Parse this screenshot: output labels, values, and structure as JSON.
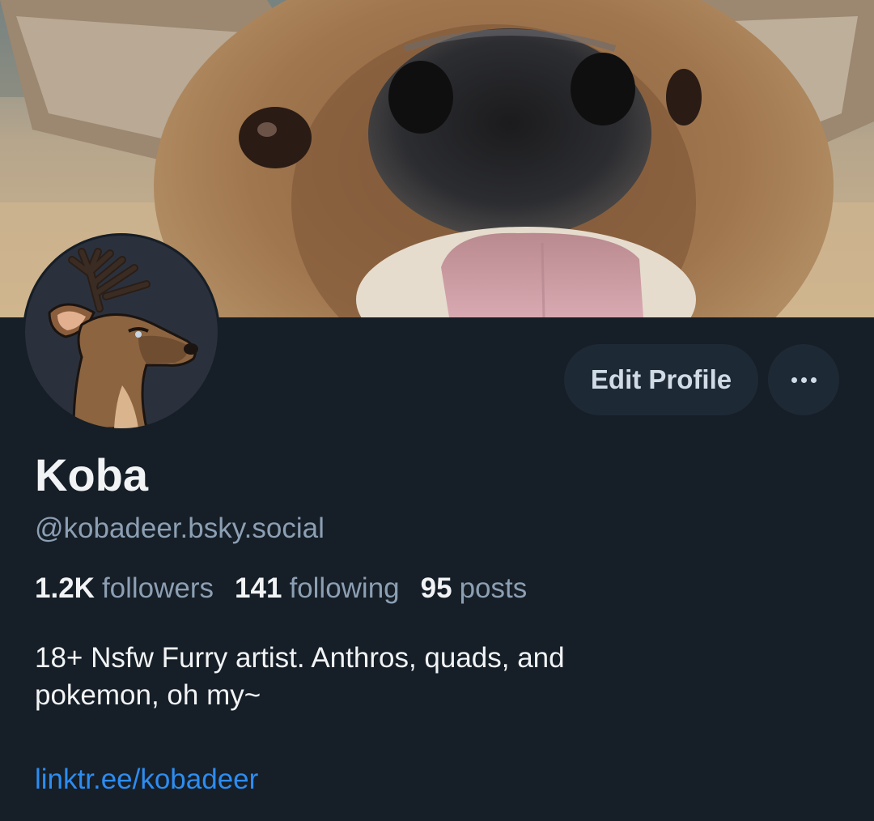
{
  "profile": {
    "display_name": "Koba",
    "handle": "@kobadeer.bsky.social",
    "stats": {
      "followers_count": "1.2K",
      "followers_label": "followers",
      "following_count": "141",
      "following_label": "following",
      "posts_count": "95",
      "posts_label": "posts"
    },
    "bio_line1": "18+ Nsfw Furry artist. Anthros, quads, and",
    "bio_line2": "pokemon, oh my~",
    "link": "linktr.ee/kobadeer"
  },
  "actions": {
    "edit_label": "Edit Profile",
    "more_icon": "ellipsis-icon"
  },
  "colors": {
    "background": "#161e27",
    "button_bg": "#1e2936",
    "link": "#2d8cf0",
    "muted_text": "#8c9fb3",
    "primary_text": "#f1f3f5"
  }
}
